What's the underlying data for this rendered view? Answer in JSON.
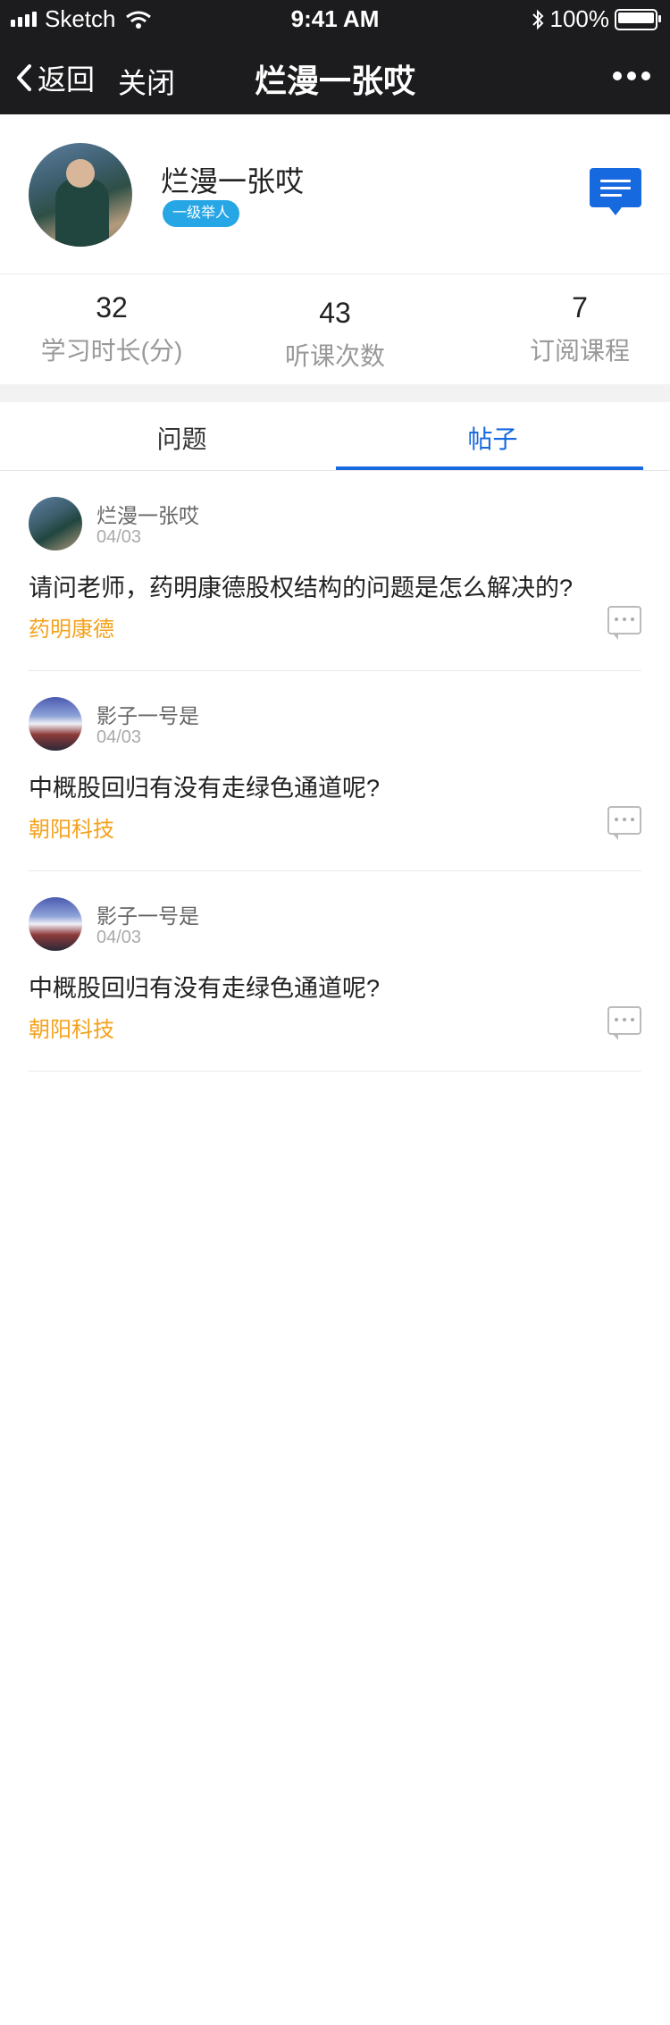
{
  "status_bar": {
    "carrier": "Sketch",
    "time": "9:41 AM",
    "battery": "100%",
    "battery_level": 1.0
  },
  "nav": {
    "back_label": "返回",
    "close_label": "关闭",
    "title": "烂漫一张哎"
  },
  "profile": {
    "name": "烂漫一张哎",
    "badge": "一级举人"
  },
  "stats": [
    {
      "value": "32",
      "label": "学习时长(分)"
    },
    {
      "value": "43",
      "label": "听课次数"
    },
    {
      "value": "7",
      "label": "订阅课程"
    }
  ],
  "tabs": {
    "questions": "问题",
    "posts": "帖子",
    "active": "posts"
  },
  "posts": [
    {
      "author": "烂漫一张哎",
      "date": "04/03",
      "question": "请问老师，药明康德股权结构的问题是怎么解决的?",
      "tag": "药明康德"
    },
    {
      "author": "影子一号是",
      "date": "04/03",
      "question": "中概股回归有没有走绿色通道呢?",
      "tag": "朝阳科技"
    },
    {
      "author": "影子一号是",
      "date": "04/03",
      "question": "中概股回归有没有走绿色通道呢?",
      "tag": "朝阳科技"
    }
  ]
}
